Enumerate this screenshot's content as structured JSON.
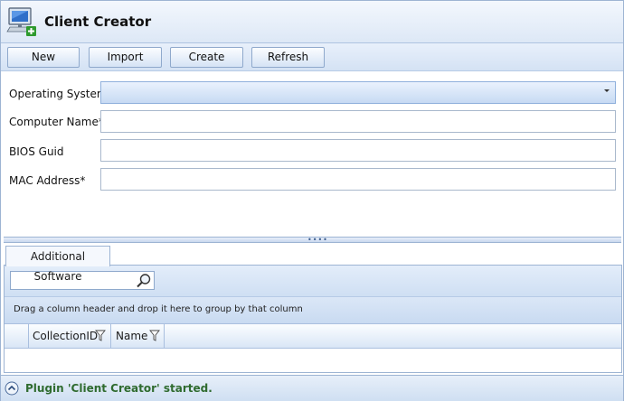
{
  "app": {
    "title": "Client Creator"
  },
  "toolbar": {
    "buttons": [
      {
        "label": "New"
      },
      {
        "label": "Import"
      },
      {
        "label": "Create"
      },
      {
        "label": "Refresh"
      }
    ]
  },
  "form": {
    "fields": [
      {
        "label": "Operating System",
        "value": ""
      },
      {
        "label": "Computer Name*",
        "value": ""
      },
      {
        "label": "BIOS Guid",
        "value": ""
      },
      {
        "label": "MAC Address*",
        "value": ""
      }
    ]
  },
  "tabs": [
    {
      "label": "Additional Software"
    }
  ],
  "grid": {
    "search_value": "",
    "group_hint": "Drag a column header and drop it here to group by that column",
    "columns": [
      {
        "label": "CollectionID"
      },
      {
        "label": "Name"
      }
    ]
  },
  "status": {
    "text": "Plugin 'Client Creator' started."
  },
  "colors": {
    "accent": "#c7daf3",
    "status_text": "#2f6b2f",
    "border": "#9db4d3"
  }
}
